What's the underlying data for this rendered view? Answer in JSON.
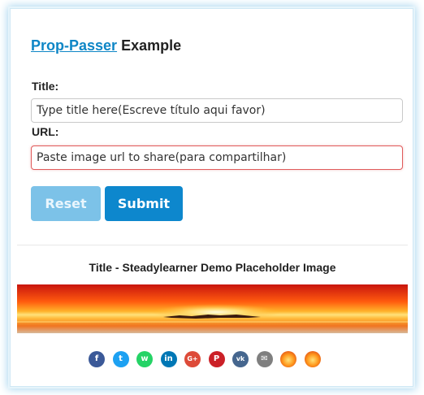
{
  "header": {
    "link_text": "Prop-Passer",
    "rest": "Example"
  },
  "form": {
    "title_label": "Title:",
    "title_placeholder": "Type title here(Escreve título aqui favor)",
    "url_label": "URL:",
    "url_placeholder": "Paste image url to share(para compartilhar)",
    "reset_label": "Reset",
    "submit_label": "Submit"
  },
  "card": {
    "title": "Title - Steadylearner Demo Placeholder Image"
  },
  "share": [
    {
      "name": "facebook-icon",
      "color": "#3b5998",
      "glyph": "f"
    },
    {
      "name": "twitter-icon",
      "color": "#1da1f2",
      "glyph": "t"
    },
    {
      "name": "whatsapp-icon",
      "color": "#25d366",
      "glyph": "w"
    },
    {
      "name": "linkedin-icon",
      "color": "#0077b5",
      "glyph": "in"
    },
    {
      "name": "google-plus-icon",
      "color": "#dd4b39",
      "glyph": "G+"
    },
    {
      "name": "pinterest-icon",
      "color": "#cb2027",
      "glyph": "P"
    },
    {
      "name": "vk-icon",
      "color": "#45668e",
      "glyph": "vk"
    },
    {
      "name": "email-icon",
      "color": "#7f7f7f",
      "glyph": "✉"
    },
    {
      "name": "sunset-icon-1",
      "color": "#f07a1a",
      "glyph": ""
    },
    {
      "name": "sunset-icon-2",
      "color": "#f07a1a",
      "glyph": ""
    }
  ]
}
